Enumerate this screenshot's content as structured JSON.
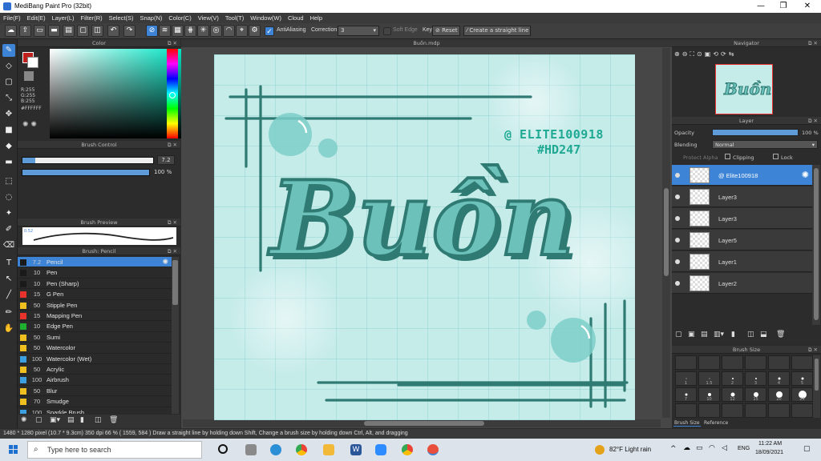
{
  "window": {
    "title": "MediBang Paint Pro (32bit)",
    "min_glyph": "—",
    "max_glyph": "❐",
    "close_glyph": "✕"
  },
  "menu": [
    "File(F)",
    "Edit(E)",
    "Layer(L)",
    "Filter(R)",
    "Select(S)",
    "Snap(N)",
    "Color(C)",
    "View(V)",
    "Tool(T)",
    "Window(W)",
    "Cloud",
    "Help"
  ],
  "toolbar": {
    "antialiasing_label": "AntiAliasing",
    "correction_label": "Correction",
    "correction_value": "3",
    "soft_edge_label": "Soft Edge",
    "key_label": "Key",
    "reset_label": "Reset",
    "straight_line_label": "Create a straight line"
  },
  "color_panel": {
    "title": "Color",
    "r": "R:255",
    "g": "G:255",
    "b": "B:255",
    "hex": "#FFFFFF"
  },
  "brush_control": {
    "title": "Brush Control",
    "size_value": "7.2",
    "opacity_value": "100 %",
    "size_fraction": 0.1,
    "opacity_fraction": 1.0
  },
  "brush_preview": {
    "title": "Brush Preview",
    "size_value": "0.52"
  },
  "brush_list": {
    "title": "Brush: Pencil",
    "items": [
      {
        "size": "7.2",
        "name": "Pencil",
        "color": "#1a1a1a",
        "active": true
      },
      {
        "size": "10",
        "name": "Pen",
        "color": "#1a1a1a"
      },
      {
        "size": "10",
        "name": "Pen (Sharp)",
        "color": "#1a1a1a"
      },
      {
        "size": "15",
        "name": "G Pen",
        "color": "#e8322c"
      },
      {
        "size": "50",
        "name": "Stipple Pen",
        "color": "#f0c020"
      },
      {
        "size": "15",
        "name": "Mapping Pen",
        "color": "#e8322c"
      },
      {
        "size": "10",
        "name": "Edge Pen",
        "color": "#20b030"
      },
      {
        "size": "50",
        "name": "Sumi",
        "color": "#f0c020"
      },
      {
        "size": "50",
        "name": "Watercolor",
        "color": "#f0c020"
      },
      {
        "size": "100",
        "name": "Watercolor (Wet)",
        "color": "#3ca0e0"
      },
      {
        "size": "50",
        "name": "Acrylic",
        "color": "#f0c020"
      },
      {
        "size": "100",
        "name": "Airbrush",
        "color": "#3ca0e0"
      },
      {
        "size": "50",
        "name": "Blur",
        "color": "#f0c020"
      },
      {
        "size": "70",
        "name": "Smudge",
        "color": "#f0c020"
      },
      {
        "size": "100",
        "name": "Sparkle Brush",
        "color": "#3ca0e0"
      }
    ]
  },
  "canvas": {
    "tab_title": "Buồn.mdp",
    "watermark_line1": "@ ELITE100918",
    "watermark_line2": "#HD247",
    "artwork_word": "Buồn",
    "ink_color": "#2f7b73",
    "accent_color": "#6cc2bb",
    "paper_color": "#c6ecea"
  },
  "navigator": {
    "title": "Navigator"
  },
  "layer_panel": {
    "title": "Layer",
    "opacity_label": "Opacity",
    "opacity_value": "100 %",
    "blending_label": "Blending",
    "blending_value": "Normal",
    "protect_alpha_label": "Protect Alpha",
    "clipping_label": "Clipping",
    "lock_label": "Lock",
    "layers": [
      {
        "name": "@ Elite100918",
        "active": true
      },
      {
        "name": "Layer3"
      },
      {
        "name": "Layer3"
      },
      {
        "name": "Layer5"
      },
      {
        "name": "Layer1"
      },
      {
        "name": "Layer2"
      }
    ]
  },
  "brush_size_panel": {
    "title": "Brush Size",
    "tab_brush_size": "Brush Size",
    "tab_reference": "Reference",
    "row1": [
      "1",
      "1.5",
      "2",
      "3",
      "4",
      "5"
    ],
    "row2": [
      "7",
      "10",
      "12",
      "15",
      "20",
      "25"
    ]
  },
  "status": {
    "text": "1480 * 1280 pixel   (10.7 * 9.3cm)   350 dpi   66 %   ( 1559, 584 )   Draw a straight line by holding down Shift, Change a brush size by holding down Ctrl, Alt, and dragging"
  },
  "taskbar": {
    "search_placeholder": "Type here to search",
    "weather": "82°F  Light rain",
    "lang": "ENG",
    "time": "11:22 AM",
    "date": "18/09/2021"
  }
}
